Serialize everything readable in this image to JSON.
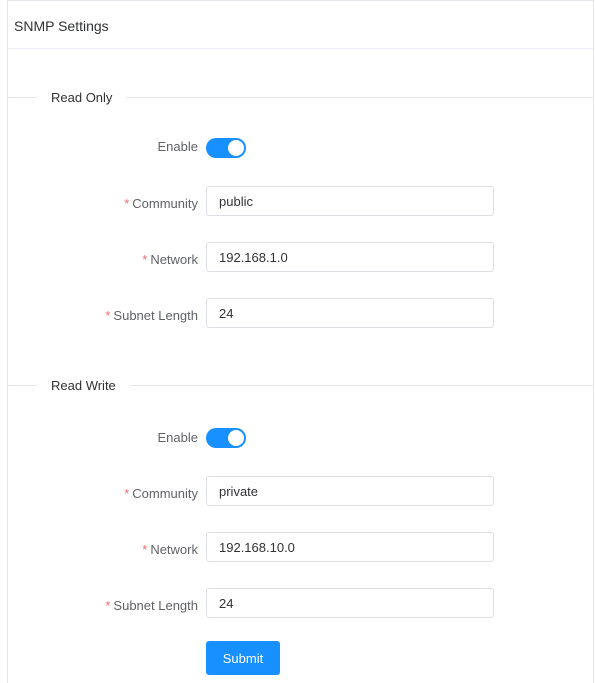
{
  "card": {
    "title": "SNMP Settings"
  },
  "sections": [
    {
      "title": "Read Only",
      "enable_label": "Enable",
      "enabled": true,
      "community_label": "Community",
      "community_value": "public",
      "network_label": "Network",
      "network_value": "192.168.1.0",
      "subnet_label": "Subnet Length",
      "subnet_value": "24"
    },
    {
      "title": "Read Write",
      "enable_label": "Enable",
      "enabled": true,
      "community_label": "Community",
      "community_value": "private",
      "network_label": "Network",
      "network_value": "192.168.10.0",
      "subnet_label": "Subnet Length",
      "subnet_value": "24"
    }
  ],
  "required_mark": "*",
  "submit_label": "Submit",
  "colors": {
    "accent": "#1890ff",
    "required": "#f56c6c"
  }
}
